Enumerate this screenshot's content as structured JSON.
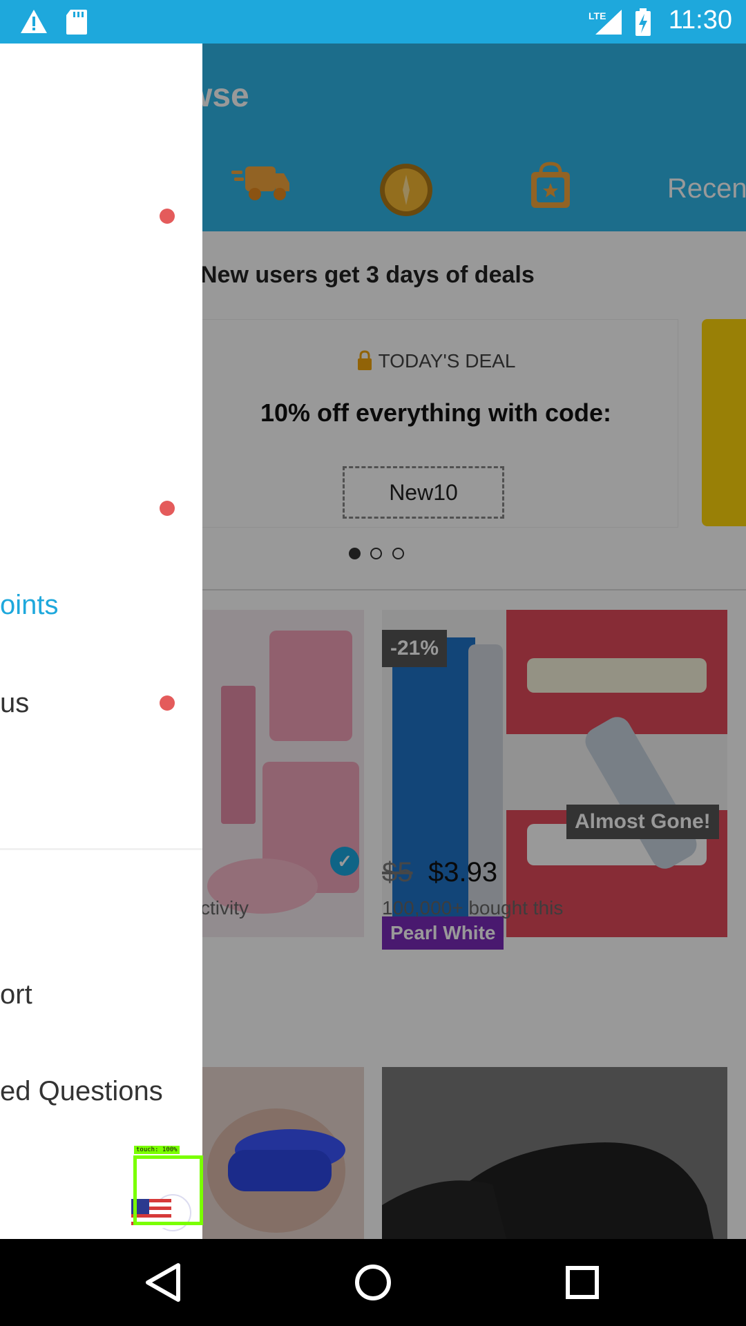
{
  "status_bar": {
    "time": "11:30",
    "network": "LTE"
  },
  "app_bar": {
    "title_partial": "wse",
    "recent_tab_partial": "Recen"
  },
  "promo": {
    "text": "New users get 3 days of deals",
    "deal_label": "TODAY'S DEAL",
    "deal_title": "10% off everything with code:",
    "coupon_code": "New10",
    "pager_dots": 3,
    "pager_active": 1
  },
  "products": [
    {
      "activity_text": "ctivity"
    },
    {
      "discount_badge": "-21%",
      "brand_tag": "Pearl White",
      "stock_badge": "Almost Gone!",
      "old_price": "$5",
      "price": "$3.93",
      "bought_text": "100,000+ bought this"
    }
  ],
  "drawer": {
    "items": [
      {
        "label": "oints",
        "active": true
      },
      {
        "label": "us",
        "active": false
      },
      {
        "label": "ort",
        "active": false
      },
      {
        "label": "ed Questions",
        "active": false
      }
    ],
    "notification_dots": 3,
    "language_flag": "US"
  },
  "overlay": {
    "touch_label": "touch: 100%"
  },
  "colors": {
    "accent": "#1ea8dc",
    "status_bar": "#1ea8dc",
    "notification": "#e45b5b",
    "touch_box": "#7aff00"
  },
  "icons": [
    "warning-icon",
    "sd-card-icon",
    "lte-signal-icon",
    "battery-charging-icon",
    "delivery-truck-icon",
    "coin-icon",
    "shopping-bag-icon",
    "lock-icon",
    "verified-check-icon",
    "us-flag-icon",
    "back-icon",
    "home-icon",
    "recents-icon"
  ]
}
